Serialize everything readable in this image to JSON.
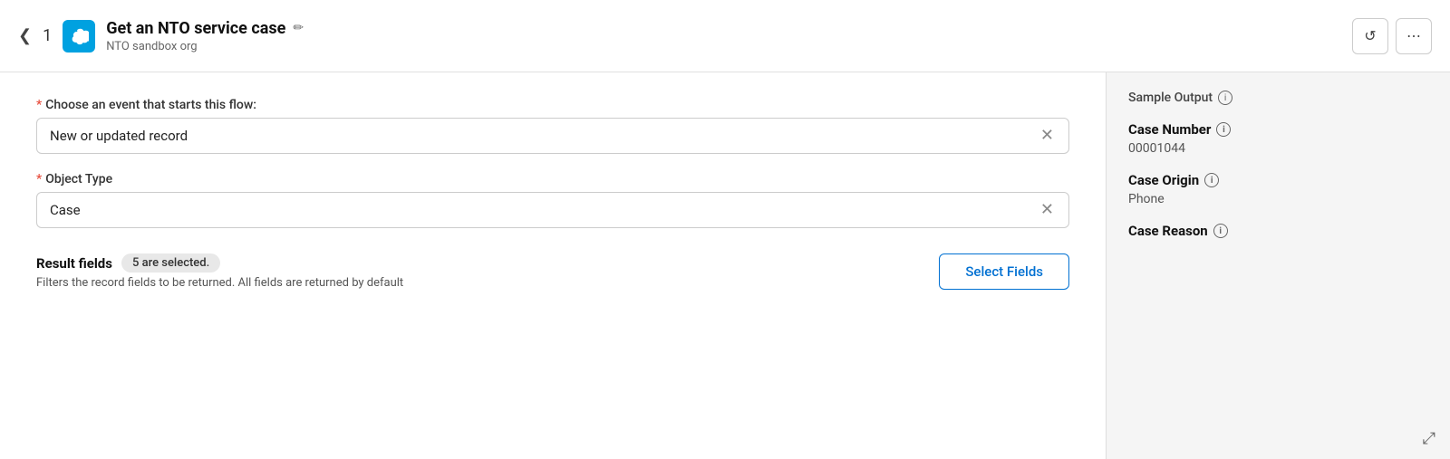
{
  "header": {
    "chevron": "❮",
    "step_number": "1",
    "title": "Get an NTO service case",
    "subtitle": "NTO sandbox org",
    "edit_icon": "✏",
    "refresh_icon": "↺",
    "more_icon": "⋯"
  },
  "form": {
    "event_label": "Choose an event that starts this flow:",
    "event_value": "New or updated record",
    "object_label": "Object Type",
    "object_value": "Case"
  },
  "result_fields": {
    "label": "Result fields",
    "badge": "5 are selected.",
    "description": "Filters the record fields to be returned. All fields are returned by default",
    "select_button": "Select Fields"
  },
  "sample_output": {
    "title": "Sample Output",
    "fields": [
      {
        "name": "Case Number",
        "value": "00001044"
      },
      {
        "name": "Case Origin",
        "value": "Phone"
      },
      {
        "name": "Case Reason",
        "value": ""
      }
    ]
  }
}
